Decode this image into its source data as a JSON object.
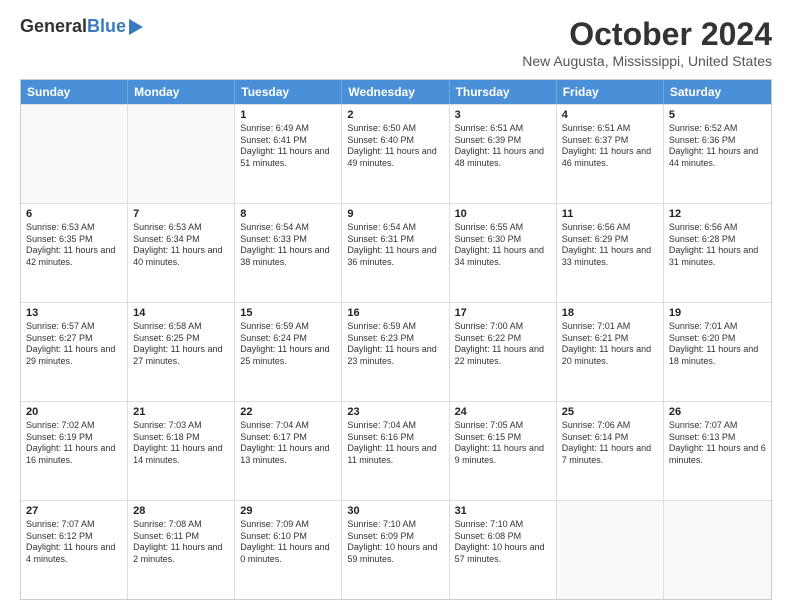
{
  "logo": {
    "general": "General",
    "blue": "Blue"
  },
  "title": "October 2024",
  "location": "New Augusta, Mississippi, United States",
  "days_of_week": [
    "Sunday",
    "Monday",
    "Tuesday",
    "Wednesday",
    "Thursday",
    "Friday",
    "Saturday"
  ],
  "weeks": [
    [
      {
        "day": "",
        "sunrise": "",
        "sunset": "",
        "daylight": "",
        "empty": true
      },
      {
        "day": "",
        "sunrise": "",
        "sunset": "",
        "daylight": "",
        "empty": true
      },
      {
        "day": "1",
        "sunrise": "Sunrise: 6:49 AM",
        "sunset": "Sunset: 6:41 PM",
        "daylight": "Daylight: 11 hours and 51 minutes."
      },
      {
        "day": "2",
        "sunrise": "Sunrise: 6:50 AM",
        "sunset": "Sunset: 6:40 PM",
        "daylight": "Daylight: 11 hours and 49 minutes."
      },
      {
        "day": "3",
        "sunrise": "Sunrise: 6:51 AM",
        "sunset": "Sunset: 6:39 PM",
        "daylight": "Daylight: 11 hours and 48 minutes."
      },
      {
        "day": "4",
        "sunrise": "Sunrise: 6:51 AM",
        "sunset": "Sunset: 6:37 PM",
        "daylight": "Daylight: 11 hours and 46 minutes."
      },
      {
        "day": "5",
        "sunrise": "Sunrise: 6:52 AM",
        "sunset": "Sunset: 6:36 PM",
        "daylight": "Daylight: 11 hours and 44 minutes."
      }
    ],
    [
      {
        "day": "6",
        "sunrise": "Sunrise: 6:53 AM",
        "sunset": "Sunset: 6:35 PM",
        "daylight": "Daylight: 11 hours and 42 minutes."
      },
      {
        "day": "7",
        "sunrise": "Sunrise: 6:53 AM",
        "sunset": "Sunset: 6:34 PM",
        "daylight": "Daylight: 11 hours and 40 minutes."
      },
      {
        "day": "8",
        "sunrise": "Sunrise: 6:54 AM",
        "sunset": "Sunset: 6:33 PM",
        "daylight": "Daylight: 11 hours and 38 minutes."
      },
      {
        "day": "9",
        "sunrise": "Sunrise: 6:54 AM",
        "sunset": "Sunset: 6:31 PM",
        "daylight": "Daylight: 11 hours and 36 minutes."
      },
      {
        "day": "10",
        "sunrise": "Sunrise: 6:55 AM",
        "sunset": "Sunset: 6:30 PM",
        "daylight": "Daylight: 11 hours and 34 minutes."
      },
      {
        "day": "11",
        "sunrise": "Sunrise: 6:56 AM",
        "sunset": "Sunset: 6:29 PM",
        "daylight": "Daylight: 11 hours and 33 minutes."
      },
      {
        "day": "12",
        "sunrise": "Sunrise: 6:56 AM",
        "sunset": "Sunset: 6:28 PM",
        "daylight": "Daylight: 11 hours and 31 minutes."
      }
    ],
    [
      {
        "day": "13",
        "sunrise": "Sunrise: 6:57 AM",
        "sunset": "Sunset: 6:27 PM",
        "daylight": "Daylight: 11 hours and 29 minutes."
      },
      {
        "day": "14",
        "sunrise": "Sunrise: 6:58 AM",
        "sunset": "Sunset: 6:25 PM",
        "daylight": "Daylight: 11 hours and 27 minutes."
      },
      {
        "day": "15",
        "sunrise": "Sunrise: 6:59 AM",
        "sunset": "Sunset: 6:24 PM",
        "daylight": "Daylight: 11 hours and 25 minutes."
      },
      {
        "day": "16",
        "sunrise": "Sunrise: 6:59 AM",
        "sunset": "Sunset: 6:23 PM",
        "daylight": "Daylight: 11 hours and 23 minutes."
      },
      {
        "day": "17",
        "sunrise": "Sunrise: 7:00 AM",
        "sunset": "Sunset: 6:22 PM",
        "daylight": "Daylight: 11 hours and 22 minutes."
      },
      {
        "day": "18",
        "sunrise": "Sunrise: 7:01 AM",
        "sunset": "Sunset: 6:21 PM",
        "daylight": "Daylight: 11 hours and 20 minutes."
      },
      {
        "day": "19",
        "sunrise": "Sunrise: 7:01 AM",
        "sunset": "Sunset: 6:20 PM",
        "daylight": "Daylight: 11 hours and 18 minutes."
      }
    ],
    [
      {
        "day": "20",
        "sunrise": "Sunrise: 7:02 AM",
        "sunset": "Sunset: 6:19 PM",
        "daylight": "Daylight: 11 hours and 16 minutes."
      },
      {
        "day": "21",
        "sunrise": "Sunrise: 7:03 AM",
        "sunset": "Sunset: 6:18 PM",
        "daylight": "Daylight: 11 hours and 14 minutes."
      },
      {
        "day": "22",
        "sunrise": "Sunrise: 7:04 AM",
        "sunset": "Sunset: 6:17 PM",
        "daylight": "Daylight: 11 hours and 13 minutes."
      },
      {
        "day": "23",
        "sunrise": "Sunrise: 7:04 AM",
        "sunset": "Sunset: 6:16 PM",
        "daylight": "Daylight: 11 hours and 11 minutes."
      },
      {
        "day": "24",
        "sunrise": "Sunrise: 7:05 AM",
        "sunset": "Sunset: 6:15 PM",
        "daylight": "Daylight: 11 hours and 9 minutes."
      },
      {
        "day": "25",
        "sunrise": "Sunrise: 7:06 AM",
        "sunset": "Sunset: 6:14 PM",
        "daylight": "Daylight: 11 hours and 7 minutes."
      },
      {
        "day": "26",
        "sunrise": "Sunrise: 7:07 AM",
        "sunset": "Sunset: 6:13 PM",
        "daylight": "Daylight: 11 hours and 6 minutes."
      }
    ],
    [
      {
        "day": "27",
        "sunrise": "Sunrise: 7:07 AM",
        "sunset": "Sunset: 6:12 PM",
        "daylight": "Daylight: 11 hours and 4 minutes."
      },
      {
        "day": "28",
        "sunrise": "Sunrise: 7:08 AM",
        "sunset": "Sunset: 6:11 PM",
        "daylight": "Daylight: 11 hours and 2 minutes."
      },
      {
        "day": "29",
        "sunrise": "Sunrise: 7:09 AM",
        "sunset": "Sunset: 6:10 PM",
        "daylight": "Daylight: 11 hours and 0 minutes."
      },
      {
        "day": "30",
        "sunrise": "Sunrise: 7:10 AM",
        "sunset": "Sunset: 6:09 PM",
        "daylight": "Daylight: 10 hours and 59 minutes."
      },
      {
        "day": "31",
        "sunrise": "Sunrise: 7:10 AM",
        "sunset": "Sunset: 6:08 PM",
        "daylight": "Daylight: 10 hours and 57 minutes."
      },
      {
        "day": "",
        "sunrise": "",
        "sunset": "",
        "daylight": "",
        "empty": true
      },
      {
        "day": "",
        "sunrise": "",
        "sunset": "",
        "daylight": "",
        "empty": true
      }
    ]
  ]
}
